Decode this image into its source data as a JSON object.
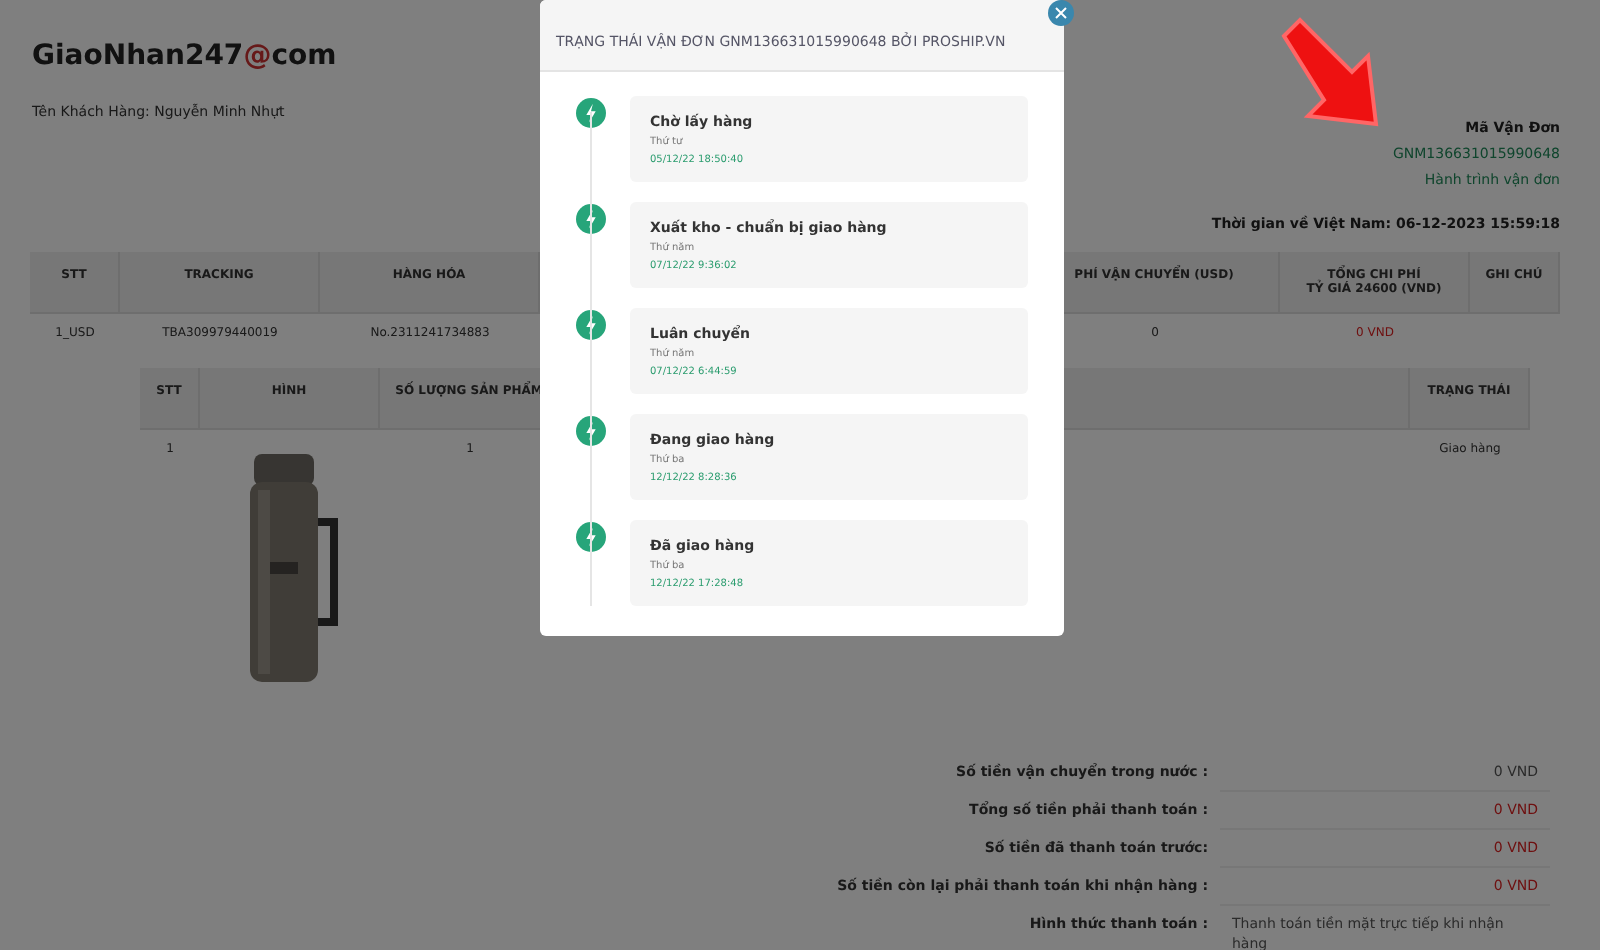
{
  "logo": {
    "text": "GiaoNhan247",
    "mark": "@",
    "suffix": "com"
  },
  "customer": {
    "label": "Tên Khách Hàng: Nguyễn Minh Nhựt"
  },
  "waybill": {
    "label": "Mã Vận Đơn",
    "code": "GNM136631015990648",
    "link": "Hành trình vận đơn",
    "arrival": "Thời gian về Việt Nam: 06-12-2023 15:59:18"
  },
  "table": {
    "columns": [
      "STT",
      "TRACKING",
      "HÀNG HÓA",
      "PHÍ VẬN CHUYỂN (USD)",
      "TỔNG CHI PHÍ\nTỶ GIÁ 24600 (VND)",
      "GHI CHÚ"
    ],
    "rows": [
      {
        "stt": "1_USD",
        "tracking": "TBA309979440019",
        "goods": "No.2311241734883",
        "fee": "0",
        "total": "0 VND"
      }
    ]
  },
  "items": {
    "columns": [
      "STT",
      "HÌNH",
      "SỐ LƯỢNG SẢN PHẨM",
      "TRẠNG THÁI"
    ],
    "rows": [
      {
        "stt": "1",
        "quantity": "1",
        "status": "Giao hàng"
      }
    ]
  },
  "summary": [
    {
      "label": "Số tiền vận chuyển trong nước :",
      "value": "0 VND",
      "highlight": false
    },
    {
      "label": "Tổng số tiền phải thanh toán :",
      "value": "0 VND",
      "highlight": true
    },
    {
      "label": "Số tiền đã thanh toán trước:",
      "value": "0 VND",
      "highlight": true
    },
    {
      "label": "Số tiền còn lại phải thanh toán khi nhận hàng :",
      "value": "0 VND",
      "highlight": true
    },
    {
      "label": "Hình thức thanh toán :",
      "value": "Thanh toán tiền mặt trực tiếp khi nhận hàng",
      "highlight": false
    }
  ],
  "modal": {
    "title": "TRẠNG THÁI VẬN ĐƠN GNM136631015990648 BỞI PROSHIP.VN",
    "steps": [
      {
        "title": "Chờ lấy hàng",
        "day": "Thứ tư",
        "time": "05/12/22 18:50:40"
      },
      {
        "title": "Xuất kho - chuẩn bị giao hàng",
        "day": "Thứ năm",
        "time": "07/12/22 9:36:02"
      },
      {
        "title": "Luân chuyển",
        "day": "Thứ năm",
        "time": "07/12/22 6:44:59"
      },
      {
        "title": "Đang giao hàng",
        "day": "Thứ ba",
        "time": "12/12/22 8:28:36"
      },
      {
        "title": "Đã giao hàng",
        "day": "Thứ ba",
        "time": "12/12/22 17:28:48"
      }
    ]
  }
}
